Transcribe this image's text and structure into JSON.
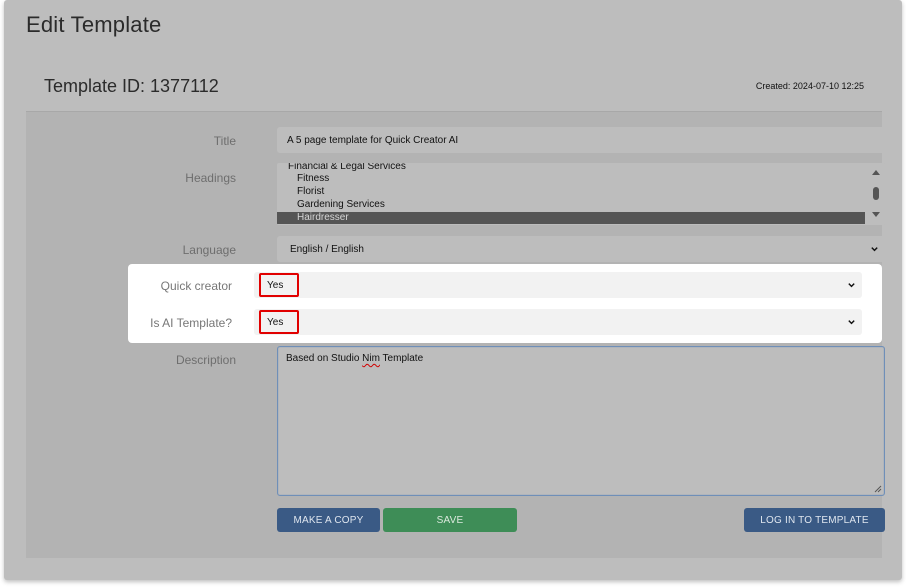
{
  "page": {
    "title": "Edit Template"
  },
  "card": {
    "title": "Template ID: 1377112",
    "created": "Created: 2024-07-10 12:25"
  },
  "form": {
    "title": {
      "label": "Title",
      "value": "A 5 page template for Quick Creator AI"
    },
    "headings": {
      "label": "Headings",
      "options": [
        {
          "text": "Financial & Legal Services",
          "kind": "group",
          "selected": false
        },
        {
          "text": "Fitness",
          "kind": "option",
          "selected": false
        },
        {
          "text": "Florist",
          "kind": "option",
          "selected": false
        },
        {
          "text": "Gardening Services",
          "kind": "option",
          "selected": false
        },
        {
          "text": "Hairdresser",
          "kind": "option",
          "selected": true
        }
      ]
    },
    "language": {
      "label": "Language",
      "value": "English / English"
    },
    "quick_creator": {
      "label": "Quick creator",
      "value": "Yes"
    },
    "is_ai_template": {
      "label": "Is AI Template?",
      "value": "Yes"
    },
    "description": {
      "label": "Description",
      "value_before": "Based on Studio ",
      "value_misspelled": "Nim",
      "value_after": " Template"
    }
  },
  "buttons": {
    "make_copy": "MAKE A COPY",
    "save": "SAVE",
    "log_in": "LOG IN TO TEMPLATE"
  },
  "colors": {
    "highlight_border": "#e10000",
    "primary_button": "#3a5a85",
    "save_button": "#3e8d57",
    "selected_option": "#555555"
  },
  "icons": {
    "dropdown": "chevron-down-icon",
    "scroll_up": "triangle-up-icon",
    "scroll_down": "triangle-down-icon",
    "resize": "resize-grip-icon"
  }
}
